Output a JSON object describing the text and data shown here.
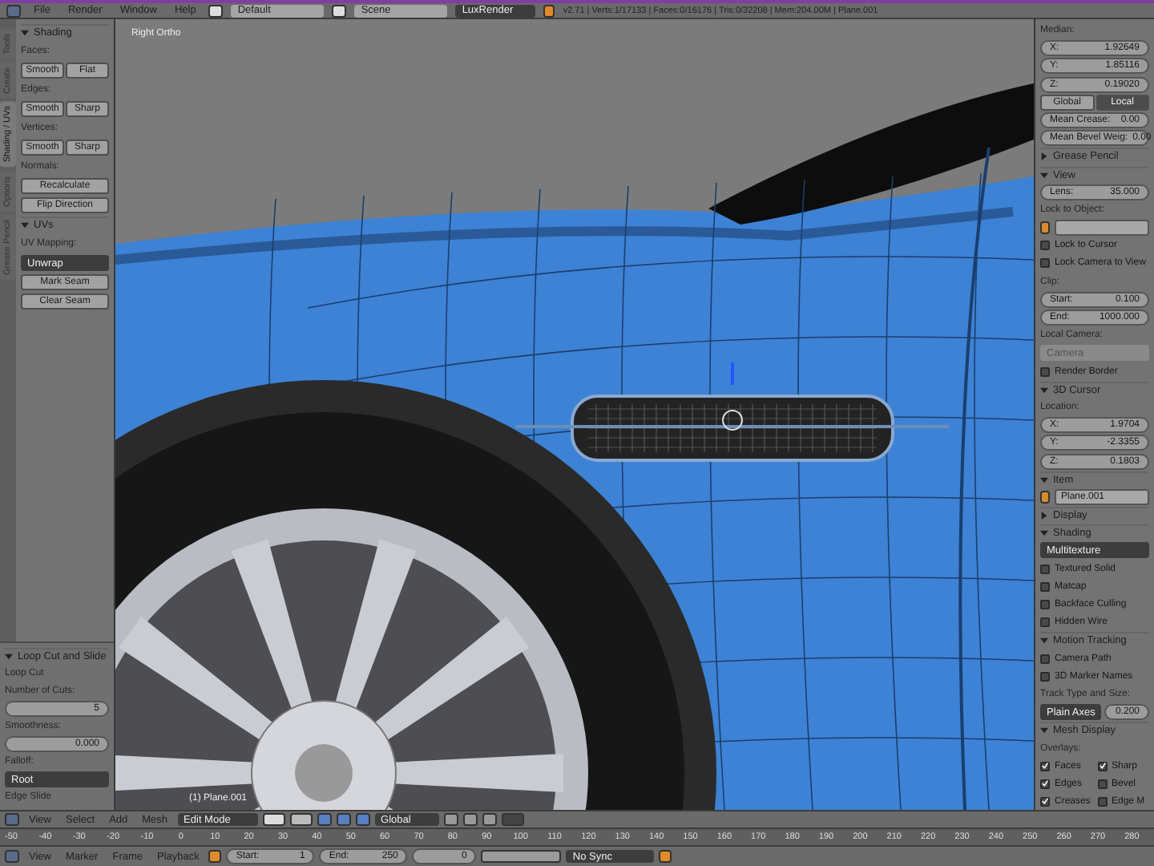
{
  "top_bar": {
    "menus": [
      "File",
      "Render",
      "Window",
      "Help"
    ],
    "layout": "Default",
    "scene": "Scene",
    "engine": "LuxRender",
    "stats": "v2.71 | Verts:1/17133 | Faces:0/16176 | Tris:0/32208 | Mem:204.00M | Plane.001"
  },
  "tool_shelf": {
    "tabs": [
      {
        "label": "Tools",
        "selected": false
      },
      {
        "label": "Create",
        "selected": false
      },
      {
        "label": "Shading / UVs",
        "selected": true
      },
      {
        "label": "Options",
        "selected": false
      },
      {
        "label": "Grease Pencil",
        "selected": false
      }
    ],
    "rows": [
      {
        "kind": "header",
        "title": "Shading",
        "expanded": true
      },
      {
        "kind": "label",
        "text": "Faces:"
      },
      {
        "kind": "buttons",
        "buttons": [
          {
            "label": "Smooth",
            "selected": false
          },
          {
            "label": "Flat",
            "selected": false
          }
        ]
      },
      {
        "kind": "label",
        "text": "Edges:"
      },
      {
        "kind": "buttons",
        "buttons": [
          {
            "label": "Smooth",
            "selected": false
          },
          {
            "label": "Sharp",
            "selected": false
          }
        ]
      },
      {
        "kind": "label",
        "text": "Vertices:"
      },
      {
        "kind": "buttons",
        "buttons": [
          {
            "label": "Smooth",
            "selected": false
          },
          {
            "label": "Sharp",
            "selected": false
          }
        ]
      },
      {
        "kind": "label",
        "text": "Normals:"
      },
      {
        "kind": "button",
        "label": "Recalculate"
      },
      {
        "kind": "button",
        "label": "Flip Direction"
      },
      {
        "kind": "header",
        "title": "UVs",
        "expanded": true
      },
      {
        "kind": "label",
        "text": "UV Mapping:"
      },
      {
        "kind": "dropdown",
        "value": "Unwrap",
        "disabled": false
      },
      {
        "kind": "button",
        "label": "Mark Seam"
      },
      {
        "kind": "button",
        "label": "Clear Seam"
      }
    ]
  },
  "operator_panel": {
    "rows": [
      {
        "kind": "header",
        "title": "Loop Cut and Slide",
        "expanded": true
      },
      {
        "kind": "label",
        "text": "Loop Cut"
      },
      {
        "kind": "label",
        "text": "Number of Cuts:"
      },
      {
        "kind": "number",
        "value": "5"
      },
      {
        "kind": "label",
        "text": "Smoothness:"
      },
      {
        "kind": "number",
        "value": "0.000"
      },
      {
        "kind": "label",
        "text": "Falloff:"
      },
      {
        "kind": "dropdown",
        "value": "Root",
        "disabled": false
      },
      {
        "kind": "label",
        "text": "Edge Slide"
      }
    ]
  },
  "viewport": {
    "label": "Right Ortho",
    "object_label": "(1) Plane.001"
  },
  "properties": {
    "rows": [
      {
        "kind": "label",
        "text": "Median:"
      },
      {
        "kind": "number",
        "label": "X:",
        "value": "1.92649"
      },
      {
        "kind": "number",
        "label": "Y:",
        "value": "1.85116"
      },
      {
        "kind": "number",
        "label": "Z:",
        "value": "0.19020"
      },
      {
        "kind": "buttons",
        "buttons": [
          {
            "label": "Global",
            "selected": false
          },
          {
            "label": "Local",
            "selected": true
          }
        ]
      },
      {
        "kind": "number",
        "label": "Mean Crease:",
        "value": "0.00"
      },
      {
        "kind": "number",
        "label": "Mean Bevel Weig:",
        "value": "0.00"
      },
      {
        "kind": "header",
        "title": "Grease Pencil",
        "expanded": false
      },
      {
        "kind": "header",
        "title": "View",
        "expanded": true
      },
      {
        "kind": "number",
        "label": "Lens:",
        "value": "35.000"
      },
      {
        "kind": "label",
        "text": "Lock to Object:"
      },
      {
        "kind": "text",
        "value": ""
      },
      {
        "kind": "checkbox",
        "label": "Lock to Cursor",
        "checked": false
      },
      {
        "kind": "checkbox",
        "label": "Lock Camera to View",
        "checked": false
      },
      {
        "kind": "label",
        "text": "Clip:"
      },
      {
        "kind": "number",
        "label": "Start:",
        "value": "0.100"
      },
      {
        "kind": "number",
        "label": "End:",
        "value": "1000.000"
      },
      {
        "kind": "label",
        "text": "Local Camera:"
      },
      {
        "kind": "dropdown",
        "value": "Camera",
        "disabled": true
      },
      {
        "kind": "checkbox",
        "label": "Render Border",
        "checked": false
      },
      {
        "kind": "header",
        "title": "3D Cursor",
        "expanded": true
      },
      {
        "kind": "label",
        "text": "Location:"
      },
      {
        "kind": "number",
        "label": "X:",
        "value": "1.9704"
      },
      {
        "kind": "number",
        "label": "Y:",
        "value": "-2.3355"
      },
      {
        "kind": "number",
        "label": "Z:",
        "value": "0.1803"
      },
      {
        "kind": "header",
        "title": "Item",
        "expanded": true
      },
      {
        "kind": "text",
        "value": "Plane.001"
      },
      {
        "kind": "header",
        "title": "Display",
        "expanded": false
      },
      {
        "kind": "header",
        "title": "Shading",
        "expanded": true
      },
      {
        "kind": "dropdown",
        "value": "Multitexture",
        "disabled": false
      },
      {
        "kind": "checkbox",
        "label": "Textured Solid",
        "checked": false
      },
      {
        "kind": "checkbox",
        "label": "Matcap",
        "checked": false
      },
      {
        "kind": "checkbox",
        "label": "Backface Culling",
        "checked": false
      },
      {
        "kind": "checkbox",
        "label": "Hidden Wire",
        "checked": false
      },
      {
        "kind": "header",
        "title": "Motion Tracking",
        "expanded": true
      },
      {
        "kind": "checkbox",
        "label": "Camera Path",
        "checked": false
      },
      {
        "kind": "checkbox",
        "label": "3D Marker Names",
        "checked": false
      },
      {
        "kind": "label",
        "text": "Track Type and Size:"
      },
      {
        "kind": "combo",
        "value": "Plain Axes",
        "field": "0.200"
      },
      {
        "kind": "header",
        "title": "Mesh Display",
        "expanded": true
      },
      {
        "kind": "label",
        "text": "Overlays:"
      },
      {
        "kind": "checkgrid",
        "items": [
          {
            "label": "Faces",
            "checked": true
          },
          {
            "label": "Sharp",
            "checked": true
          },
          {
            "label": "Edges",
            "checked": true
          },
          {
            "label": "Bevel",
            "checked": false
          },
          {
            "label": "Creases",
            "checked": true
          },
          {
            "label": "Edge M",
            "checked": false
          }
        ]
      }
    ]
  },
  "view_header": {
    "menus": [
      "View",
      "Select",
      "Add",
      "Mesh"
    ],
    "mode": "Edit Mode",
    "orientation": "Global"
  },
  "timeline": {
    "ticks": [
      "-50",
      "-40",
      "-30",
      "-20",
      "-10",
      "0",
      "10",
      "20",
      "30",
      "40",
      "50",
      "60",
      "70",
      "80",
      "90",
      "100",
      "110",
      "120",
      "130",
      "140",
      "150",
      "160",
      "170",
      "180",
      "190",
      "200",
      "210",
      "220",
      "230",
      "240",
      "250",
      "260",
      "270",
      "280"
    ],
    "menus": [
      "View",
      "Marker",
      "Frame",
      "Playback"
    ],
    "start": {
      "label": "Start:",
      "value": "1"
    },
    "end": {
      "label": "End:",
      "value": "250"
    },
    "frame": "0",
    "sync": "No Sync"
  }
}
